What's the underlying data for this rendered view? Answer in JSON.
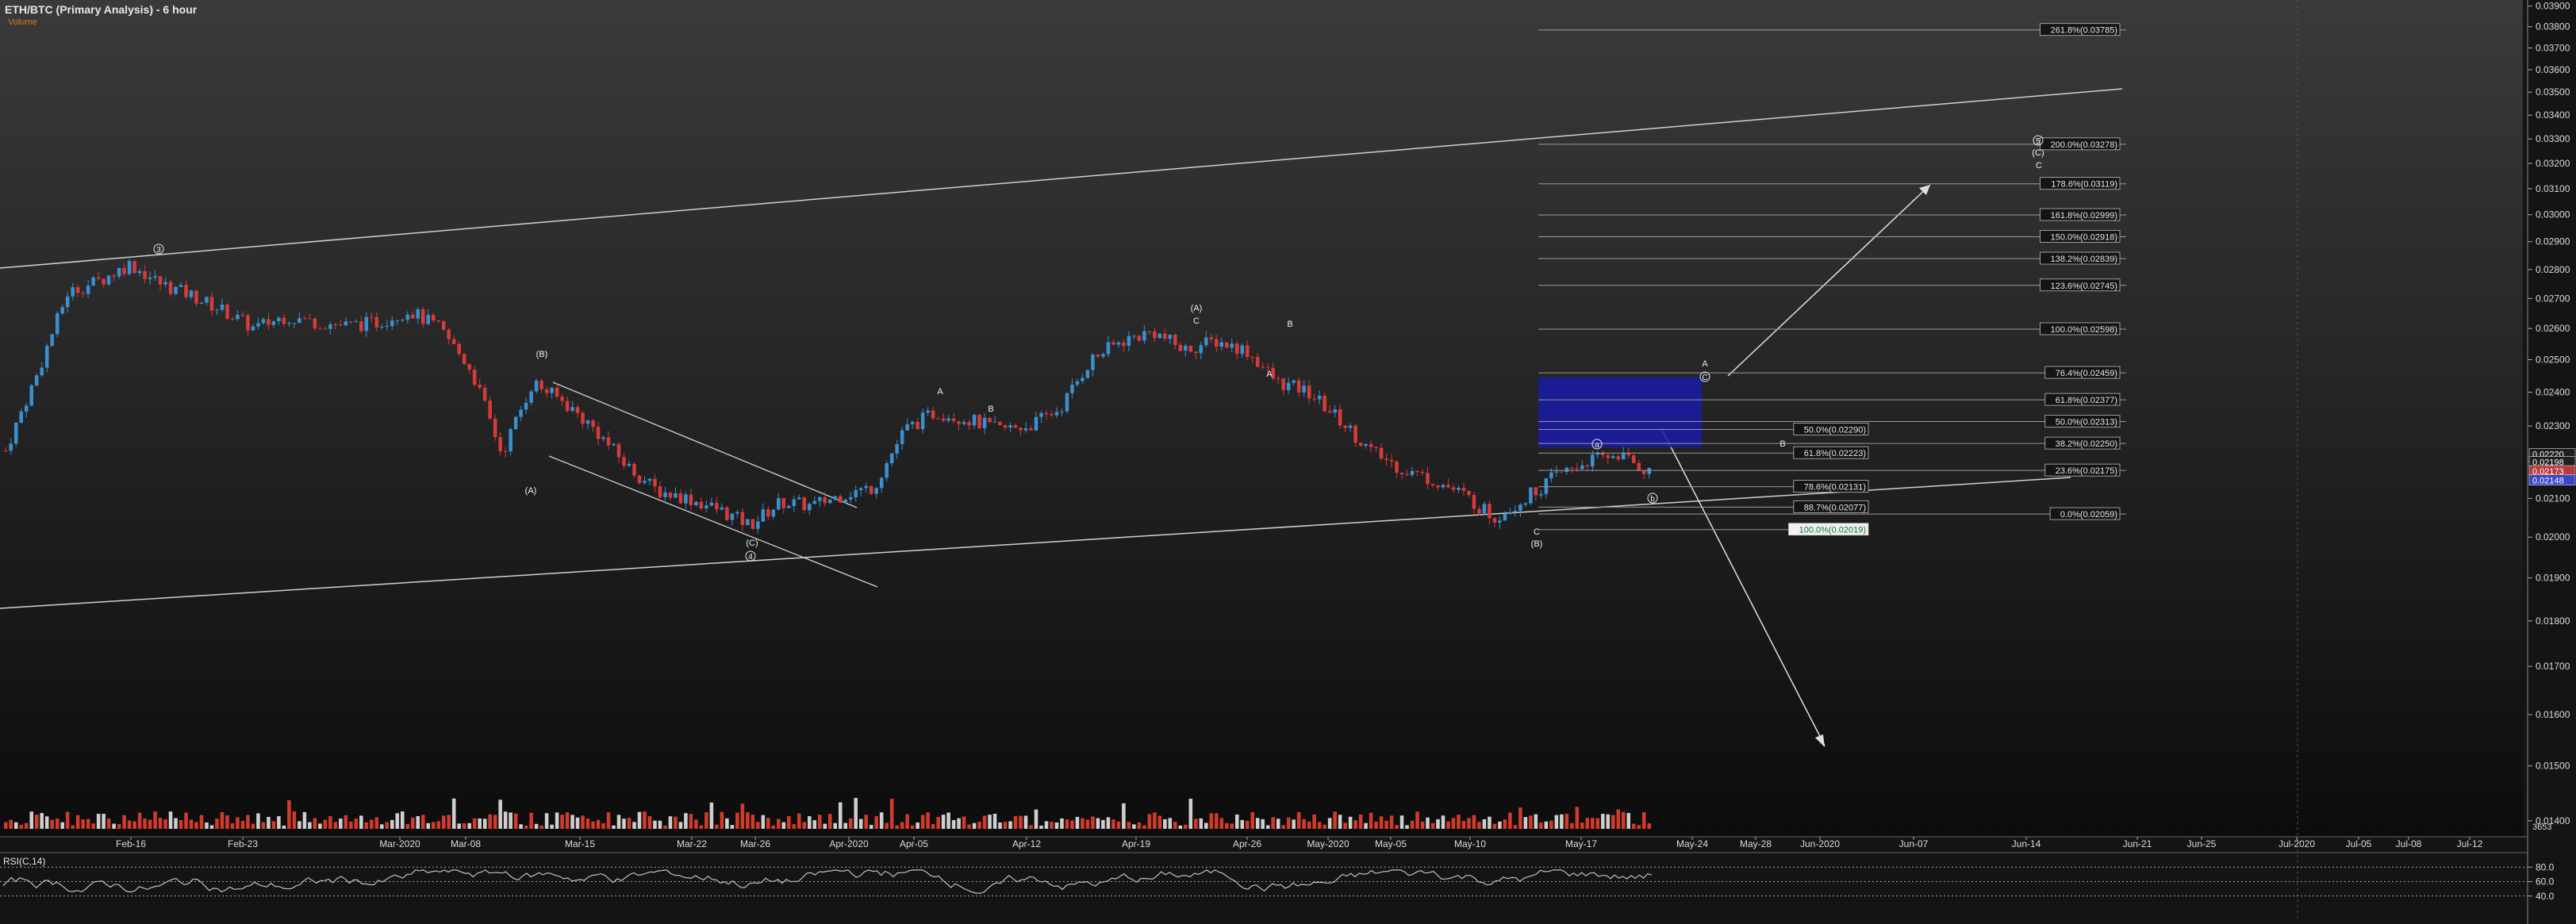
{
  "chart_data": {
    "type": "candlestick",
    "title": "ETH/BTC (Primary Analysis) - 6 hour",
    "subtitle": "Volume",
    "rsi_label": "RSI(C,14)",
    "colors": {
      "background": "#141414",
      "up": "#3a8fd0",
      "down": "#d63a3a",
      "volume_up": "#d23b2a",
      "annotation": "#e8e8e8",
      "target_box": "#1a1aa8",
      "price_tag": "#4a5bd8"
    },
    "date_axis": [
      "Feb-16",
      "Feb-23",
      "Mar-2020",
      "Mar-08",
      "Mar-15",
      "Mar-22",
      "Mar-26",
      "Apr-2020",
      "Apr-05",
      "Apr-12",
      "Apr-19",
      "Apr-26",
      "May-2020",
      "May-05",
      "May-10",
      "May-17",
      "May-24",
      "May-28",
      "Jun-2020",
      "Jun-07",
      "Jun-14",
      "Jun-21",
      "Jun-25",
      "Jul-2020",
      "Jul-05",
      "Jul-08",
      "Jul-12"
    ],
    "y_ticks": [
      "0.01400",
      "0.01500",
      "0.01600",
      "0.01700",
      "0.01800",
      "0.01900",
      "0.02000",
      "0.02100",
      "0.02200",
      "0.02300",
      "0.02400",
      "0.02500",
      "0.02600",
      "0.02700",
      "0.02800",
      "0.02900",
      "0.03000",
      "0.03100",
      "0.03200",
      "0.03300",
      "0.03400",
      "0.03500",
      "0.03600",
      "0.03700",
      "0.03800",
      "0.03900"
    ],
    "ylim": [
      0.0139,
      0.0393
    ],
    "log_scale": true,
    "rsi_ticks": [
      "80.0",
      "60.0",
      "40.0"
    ],
    "volume_label": "3653",
    "price_tags": [
      "0.02220",
      "0.02198",
      "0.02173",
      "0.02148"
    ],
    "projection_labels": [
      {
        "pct": "261.8%",
        "value": 0.03785,
        "text": "261.8%(0.03785)"
      },
      {
        "pct": "200.0%",
        "value": 0.03278,
        "text": "200.0%(0.03278)"
      },
      {
        "pct": "178.6%",
        "value": 0.03119,
        "text": "178.6%(0.03119)"
      },
      {
        "pct": "161.8%",
        "value": 0.02999,
        "text": "161.8%(0.02999)"
      },
      {
        "pct": "150.0%",
        "value": 0.02918,
        "text": "150.0%(0.02918)"
      },
      {
        "pct": "138.2%",
        "value": 0.02839,
        "text": "138.2%(0.02839)"
      },
      {
        "pct": "123.6%",
        "value": 0.02745,
        "text": "123.6%(0.02745)"
      },
      {
        "pct": "100.0%",
        "value": 0.02598,
        "text": "100.0%(0.02598)"
      },
      {
        "pct": "76.4%",
        "value": 0.02459,
        "text": "76.4%(0.02459)"
      },
      {
        "pct": "61.8%",
        "value": 0.02377,
        "text": "61.8%(0.02377)"
      },
      {
        "pct": "50.0%",
        "value": 0.02313,
        "text": "50.0%(0.02313)"
      },
      {
        "pct": "38.2%",
        "value": 0.0225,
        "text": "38.2%(0.02250)"
      },
      {
        "pct": "23.6%",
        "value": 0.02175,
        "text": "23.6%(0.02175)"
      },
      {
        "pct": "0.0%",
        "value": 0.02059,
        "text": "0.0%(0.02059)"
      }
    ],
    "retracement_labels": [
      {
        "pct": "50.0%",
        "value": 0.0229,
        "text": "50.0%(0.02290)"
      },
      {
        "pct": "61.8%",
        "value": 0.02223,
        "text": "61.8%(0.02223)"
      },
      {
        "pct": "78.6%",
        "value": 0.02131,
        "text": "78.6%(0.02131)"
      },
      {
        "pct": "88.7%",
        "value": 0.02077,
        "text": "88.7%(0.02077)"
      },
      {
        "pct": "100.0%",
        "value": 0.02019,
        "text": "100.0%(0.02019)"
      }
    ],
    "wave_labels": [
      "3",
      "(B)",
      "(A)",
      "(C)",
      "4",
      "A",
      "B",
      "(A)",
      "C",
      "B",
      "A",
      "C",
      "(B)",
      "A",
      "C",
      "5",
      "(C)",
      "C",
      "B",
      "a",
      "b"
    ],
    "price_series": {
      "x": [
        "Feb-10",
        "Feb-12",
        "Feb-14",
        "Feb-16",
        "Feb-18",
        "Feb-20",
        "Feb-22",
        "Feb-24",
        "Feb-26",
        "Feb-28",
        "Mar-01",
        "Mar-03",
        "Mar-05",
        "Mar-07",
        "Mar-09",
        "Mar-10",
        "Mar-11",
        "Mar-12",
        "Mar-13",
        "Mar-15",
        "Mar-17",
        "Mar-19",
        "Mar-21",
        "Mar-23",
        "Mar-25",
        "Mar-27",
        "Mar-29",
        "Mar-31",
        "Apr-02",
        "Apr-04",
        "Apr-06",
        "Apr-08",
        "Apr-10",
        "Apr-12",
        "Apr-14",
        "Apr-16",
        "Apr-18",
        "Apr-20",
        "Apr-22",
        "Apr-24",
        "Apr-26",
        "Apr-28",
        "Apr-30",
        "May-02",
        "May-04",
        "May-06",
        "May-08",
        "May-10",
        "May-12",
        "May-13",
        "May-15",
        "May-17",
        "May-19",
        "May-20"
      ],
      "close": [
        0.0223,
        0.0245,
        0.0272,
        0.0276,
        0.0282,
        0.0275,
        0.0271,
        0.0266,
        0.026,
        0.0264,
        0.0262,
        0.0261,
        0.0262,
        0.0266,
        0.026,
        0.0247,
        0.0222,
        0.0243,
        0.0237,
        0.0229,
        0.0219,
        0.0212,
        0.021,
        0.0207,
        0.0203,
        0.0209,
        0.0208,
        0.0211,
        0.0213,
        0.0229,
        0.0234,
        0.0232,
        0.0229,
        0.023,
        0.0235,
        0.025,
        0.0256,
        0.0259,
        0.0253,
        0.0256,
        0.0253,
        0.0243,
        0.024,
        0.0232,
        0.0223,
        0.0218,
        0.0215,
        0.0211,
        0.0205,
        0.021,
        0.0216,
        0.022,
        0.0222,
        0.0217
      ]
    }
  }
}
